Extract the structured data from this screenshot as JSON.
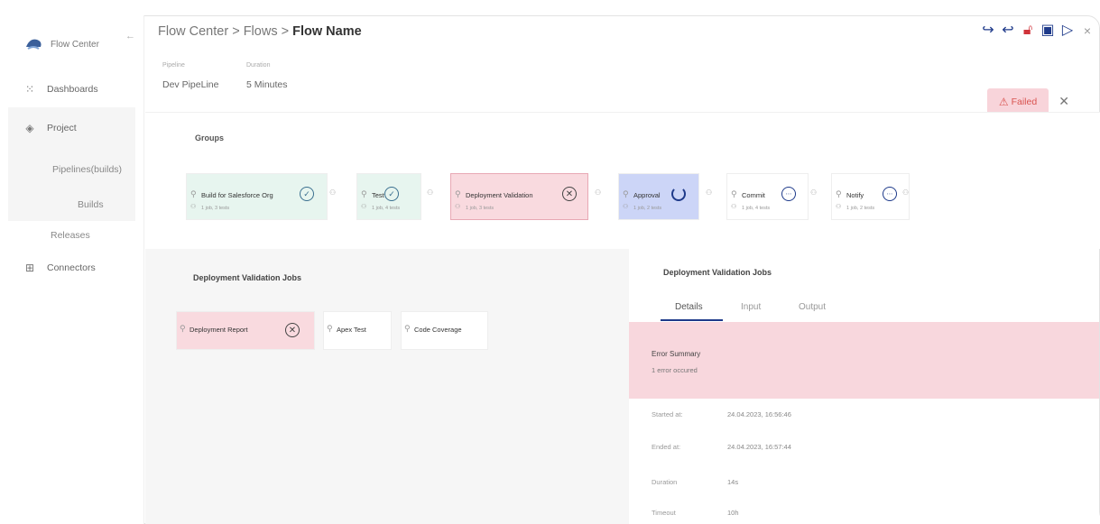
{
  "sidebar": {
    "brand": "Flow Center",
    "back_icon": "arrow-left-icon",
    "items": [
      {
        "label": "Dashboards",
        "icon": "grid-icon"
      },
      {
        "label": "Project",
        "icon": "layers-icon"
      },
      {
        "label": "Connectors",
        "icon": "connectors-icon"
      }
    ],
    "sub_items": [
      {
        "label": "Pipelines(builds)"
      },
      {
        "label": "Builds"
      },
      {
        "label": "Releases"
      }
    ]
  },
  "header": {
    "breadcrumb": [
      "Flow Center",
      "Flows",
      "Flow Name"
    ],
    "separator": ">",
    "meta": [
      {
        "label": "Pipeline",
        "value": "Dev PipeLine"
      },
      {
        "label": "Duration",
        "value": "5 Minutes"
      }
    ],
    "status": "Failed"
  },
  "groups": {
    "title": "Groups",
    "nodes": [
      {
        "name": "Build for Salesforce Org",
        "sub": "1 job, 3 tests",
        "status": "ok"
      },
      {
        "name": "Test",
        "sub": "1 job, 4 tests",
        "status": "ok"
      },
      {
        "name": "Deployment Validation",
        "sub": "1 job, 3 tests",
        "status": "fail"
      },
      {
        "name": "Approval",
        "sub": "1 job, 2 tests",
        "status": "run"
      },
      {
        "name": "Commit",
        "sub": "1 job, 4 tests",
        "status": "idle"
      },
      {
        "name": "Notify",
        "sub": "1 job, 2 tests",
        "status": "idle"
      }
    ]
  },
  "jobs": {
    "title": "Deployment Validation Jobs",
    "items": [
      {
        "name": "Deployment Report",
        "status": "fail"
      },
      {
        "name": "Apex Test",
        "status": "none"
      },
      {
        "name": "Code Coverage",
        "status": "none"
      }
    ]
  },
  "detail": {
    "title": "Deployment Validation Jobs",
    "tabs": [
      "Details",
      "Input",
      "Output"
    ],
    "active_tab": "Details",
    "error_title": "Error Summary",
    "error_sub": "1 error occured",
    "fields": [
      {
        "key": "Started at:",
        "value": "24.04.2023, 16:56:46"
      },
      {
        "key": "Ended at:",
        "value": "24.04.2023, 16:57:44"
      },
      {
        "key": "Duration",
        "value": "14s"
      },
      {
        "key": "Timeout",
        "value": "10h"
      }
    ]
  },
  "toolbar": {
    "icons": [
      "redo-icon",
      "undo-icon",
      "unlock-icon",
      "save-icon",
      "play-icon",
      "close-icon"
    ]
  },
  "colors": {
    "accent": "#1e3a8a",
    "fail_bg": "#f9dadf",
    "ok_bg": "#e7f5ef",
    "run_bg": "#ccd5f7"
  }
}
